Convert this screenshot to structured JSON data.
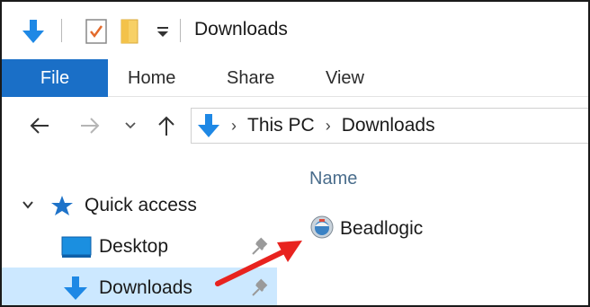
{
  "window": {
    "title": "Downloads"
  },
  "quick_access_toolbar": {
    "icons": [
      "download-arrow-icon",
      "properties-icon",
      "new-folder-icon",
      "customize-dropdown-icon"
    ]
  },
  "ribbon": {
    "tabs": [
      {
        "label": "File",
        "active": true
      },
      {
        "label": "Home",
        "active": false
      },
      {
        "label": "Share",
        "active": false
      },
      {
        "label": "View",
        "active": false
      }
    ]
  },
  "address_bar": {
    "crumbs": [
      "This PC",
      "Downloads"
    ]
  },
  "nav_pane": {
    "quick_access_label": "Quick access",
    "items": [
      {
        "label": "Desktop",
        "pinned": true,
        "selected": false
      },
      {
        "label": "Downloads",
        "pinned": true,
        "selected": true
      }
    ]
  },
  "file_list": {
    "column_header": "Name",
    "files": [
      {
        "name": "Beadlogic"
      }
    ]
  },
  "annotation": {
    "arrow_color": "#e8231f"
  },
  "colors": {
    "accent": "#1a6fc7",
    "selection": "#cce8ff",
    "download_blue": "#1e88e5"
  }
}
